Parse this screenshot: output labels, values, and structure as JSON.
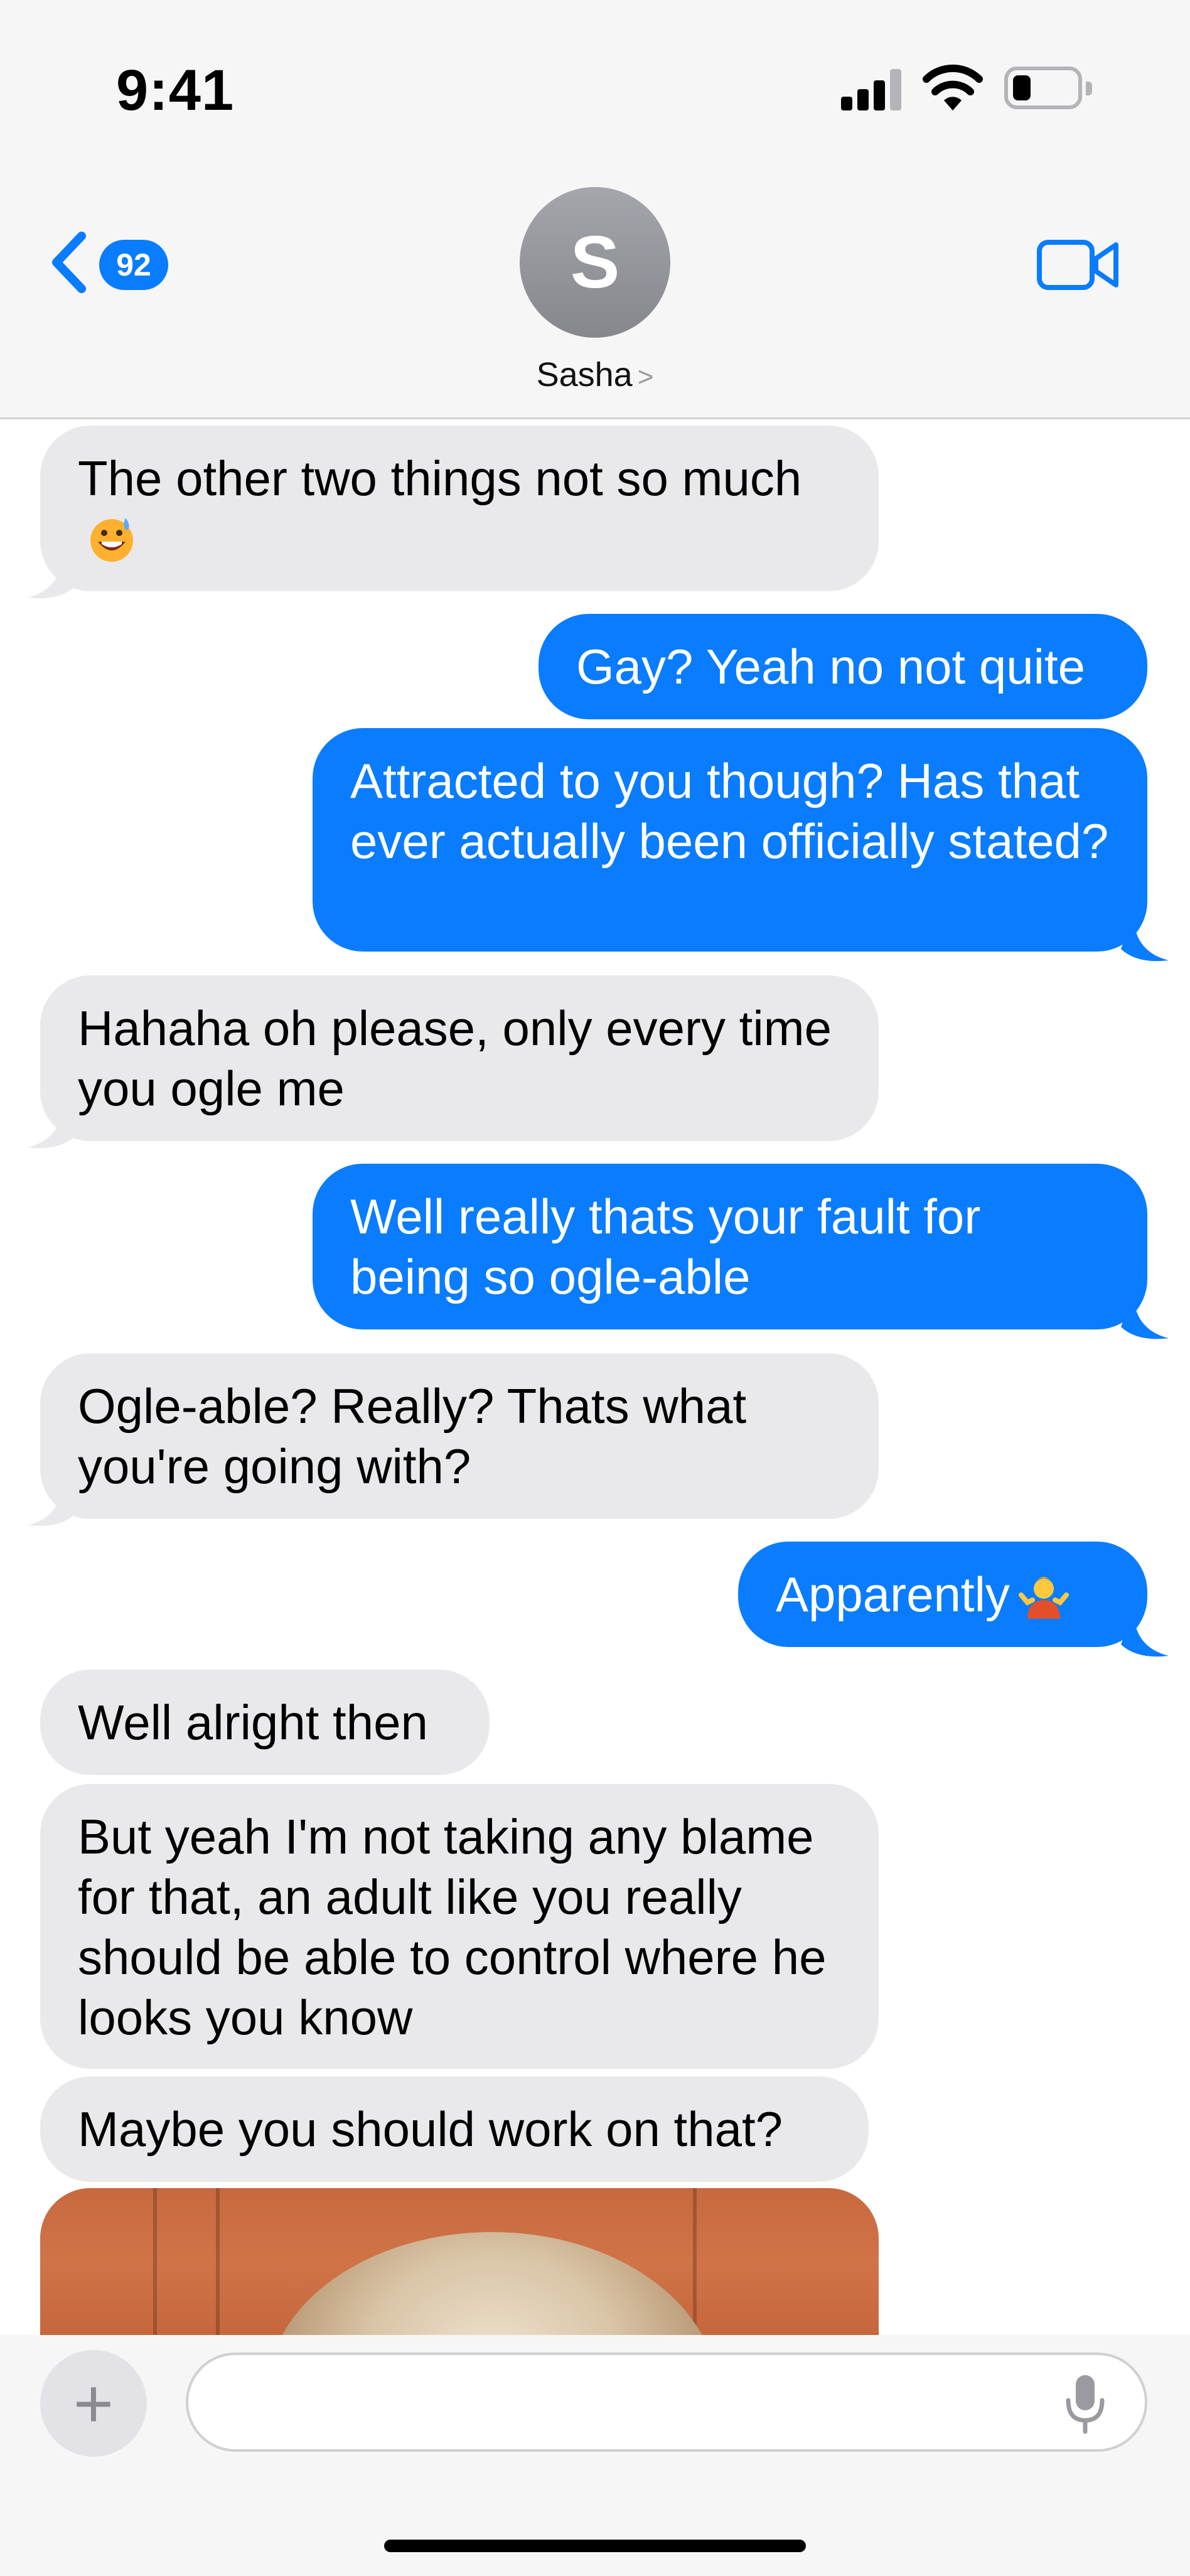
{
  "status_bar": {
    "time": "9:41"
  },
  "nav": {
    "back_badge": "92",
    "avatar_initial": "S",
    "contact_name": "Sasha",
    "contact_chevron": ">"
  },
  "messages": [
    {
      "from": "them",
      "text": "The other two things not so much",
      "emoji": "grinning-sweat-emoji"
    },
    {
      "from": "me",
      "text": "Gay? Yeah no not quite"
    },
    {
      "from": "me",
      "text": "Attracted to you though? Has that ever actually been officially stated?"
    },
    {
      "from": "them",
      "text": "Hahaha oh please, only every time you ogle me"
    },
    {
      "from": "me",
      "text": "Well really thats your fault for being so ogle-able"
    },
    {
      "from": "them",
      "text": "Ogle-able? Really? Thats what you're going with?"
    },
    {
      "from": "me",
      "text": "Apparently",
      "emoji": "person-shrugging-emoji"
    },
    {
      "from": "them",
      "text": "Well alright then"
    },
    {
      "from": "them",
      "text": "But yeah I'm not taking any blame for that, an adult like you really should be able to control where he looks you know"
    },
    {
      "from": "them",
      "text": "Maybe you should work on that?"
    }
  ],
  "input": {
    "plus_label": "+",
    "placeholder": ""
  },
  "colors": {
    "sent_bubble": "#0a7cff",
    "received_bubble": "#e9e9eb",
    "accent": "#0a7cff"
  }
}
